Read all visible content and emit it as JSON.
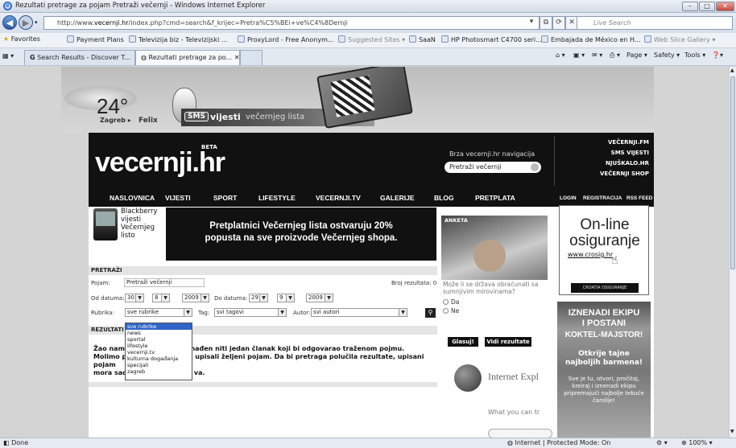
{
  "window": {
    "title": "Rezultati pretrage za pojam Pretraži večernji - Windows Internet Explorer"
  },
  "address": {
    "url_prefix": "http://www.",
    "url_domain": "vecernji.hr",
    "url_rest": "/index.php?cmd=search&f_krijec=Pretra%C5%BEi+ve%C4%8Dernji",
    "search_placeholder": "Live Search"
  },
  "favorites": {
    "label": "Favorites",
    "items": [
      "Payment Plans",
      "Televizija biz - Televizijski ...",
      "ProxyLord - Free Anonym...",
      "Suggested Sites ▾",
      "SaaN",
      "HP Photosmart C4700 seri...",
      "Embajada de México en H...",
      "Web Slice Gallery ▾"
    ]
  },
  "tabs": [
    {
      "label": "Search Results - Discover T..."
    },
    {
      "label": "Rezultati pretrage za po..."
    }
  ],
  "commands": {
    "page": "Page ▾",
    "safety": "Safety ▾",
    "tools": "Tools ▾"
  },
  "weather": {
    "temp": "24°",
    "city": "Zagreb ▸",
    "mascot": "Felix"
  },
  "sms": {
    "logo": "SMS",
    "vijesti": "vijesti",
    "lista": "večernjeg lista"
  },
  "header": {
    "logo": "vecernji.hr",
    "beta": "BETA",
    "nav_title": "Brza vecernji.hr navigacija",
    "nav_search": "Pretraži večernji",
    "links": [
      "VEČERNJI.FM",
      "SMS VIJESTI",
      "NJUŠKALO.HR",
      "VEČERNJI SHOP"
    ]
  },
  "nav": {
    "items": [
      "NASLOVNICA",
      "VIJESTI",
      "SPORT",
      "LIFESTYLE",
      "VECERNJI.TV",
      "GALERIJE",
      "BLOG",
      "PRETPLATA"
    ],
    "small": [
      "LOGIN",
      "REGISTRACIJA",
      "RSS FEED"
    ]
  },
  "blackberry": {
    "lines": [
      "Blackberry",
      "vijesti",
      "Večernjeg",
      "listo"
    ]
  },
  "promo": {
    "line1": "Pretplatnici Večernjeg lista ostvaruju 20%",
    "line2": "popusta na sve proizvode Večernjeg shopa."
  },
  "search": {
    "header": "PRETRAŽI",
    "pojam_label": "Pojam:",
    "pojam_value": "Pretraži večernji",
    "count": "Broj rezultata: 0",
    "od_label": "Od datuma:",
    "od_d": "30",
    "od_m": "8",
    "od_y": "2009",
    "do_label": "Do datuma:",
    "do_d": "29",
    "do_m": "9",
    "do_y": "2009",
    "rubrika_label": "Rubrika:",
    "rubrika_value": "sve rubrike",
    "tag_label": "Tag:",
    "tag_value": "svi tagovi",
    "autor_label": "Autor:",
    "autor_value": "svi autori",
    "rubrika_options": [
      "sve rubrike",
      "news",
      "sportal",
      "lifestyle",
      "vecernji.tv",
      "kulturna događanja",
      "specijali",
      "zagreb"
    ]
  },
  "results": {
    "header": "REZULTATI PI",
    "line1a": "Žao nam j",
    "line1b": "nađen niti jedan članak koji bi odgovarao traženom pojmu.",
    "line2a": "Molimo p",
    "line2b": "upisali željeni pojam. Da bi pretraga polučila rezultate, upisani pojam",
    "line3a": "mora sad",
    "line3b": "va."
  },
  "anketa": {
    "header": "ANKETA",
    "question": "Može li se država obraćunati sa sumnjivim mirovinama?",
    "yes": "Da",
    "no": "Ne",
    "vote": "Glasuj!",
    "results": "Vidi rezultate"
  },
  "iead": {
    "title": "Internet Expl",
    "question": "What you can tr"
  },
  "ad1": {
    "line1": "On-line",
    "line2": "osiguranje",
    "url": "www.crosig.hr",
    "bar": "CROATIA OSIGURANJE"
  },
  "ad2": {
    "t1a": "IZNENADI EKIPU",
    "t1b": "I POSTANI",
    "t2": "KOKTEL-MAJSTOR!",
    "t3a": "Otkrije tajne",
    "t3b": "najboljih barmena!",
    "t4": "Sve je tu, otvori, pročitaj, kreiraj i iznenadi ekipu pripremajući najbolje tekuće čarolije!"
  },
  "status": {
    "left": "Done",
    "zone": "Internet | Protected Mode: On",
    "zoom": "100%"
  }
}
